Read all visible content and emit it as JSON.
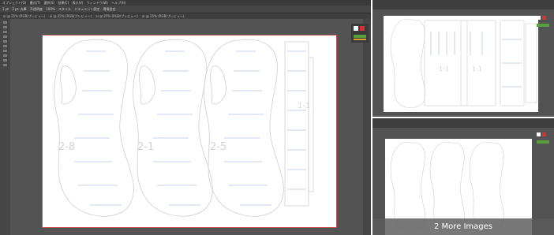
{
  "main": {
    "menu": [
      "オブジェクト(O)",
      "書式(T)",
      "選択(S)",
      "効果(C)",
      "表示(V)",
      "ウィンドウ(W)",
      "ヘルプ(H)"
    ],
    "control_bar": {
      "stroke": "1 pt",
      "mode": "3 pt. 丸筆",
      "opacity_label": "不透明度",
      "opacity": "100%",
      "style_label": "スタイル",
      "doc_setup": "ドキュメント設定",
      "env_setup": "環境設定"
    },
    "tabs": [
      "ai @ 25% (RGB/プレビュー)",
      "ai @ 25% (RGB/プレビュー)",
      "ai @ 25% (RGB/プレビュー)",
      "ai @ 25% (RGB/プレビュー)"
    ],
    "pieces": [
      {
        "label": "2-8"
      },
      {
        "label": "2-1"
      },
      {
        "label": "2-5"
      },
      {
        "label": "1-1"
      }
    ]
  },
  "side_panels": {
    "labels": [
      "1-1",
      "1-1"
    ],
    "more_images": "2 More Images"
  },
  "colors": {
    "app_bg": "#535353",
    "artboard": "#ffffff",
    "artboard_border": "#c05252",
    "guide_blue": "#8aa8d8",
    "outline": "#cfcfd6"
  }
}
